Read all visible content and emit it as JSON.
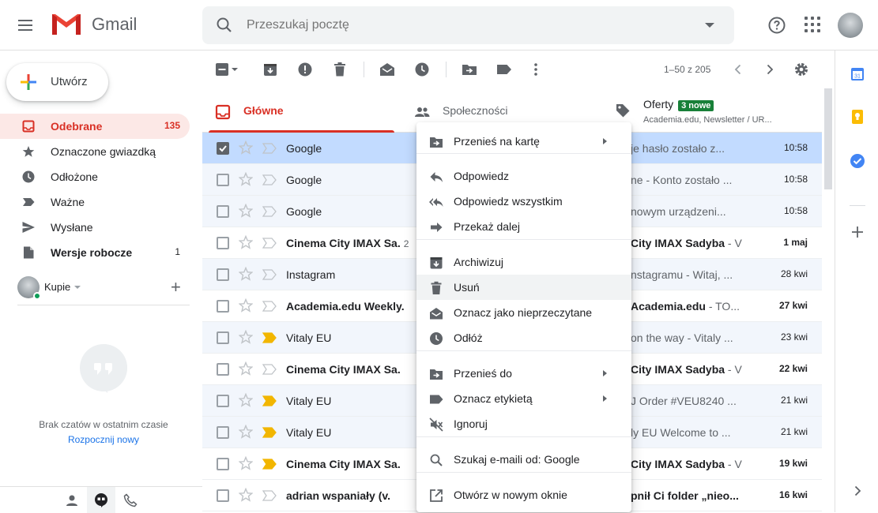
{
  "app": {
    "name": "Gmail"
  },
  "search": {
    "placeholder": "Przeszukaj pocztę"
  },
  "compose": {
    "label": "Utwórz"
  },
  "nav": [
    {
      "label": "Odebrane",
      "count": "135",
      "icon": "inbox-icon",
      "active": true
    },
    {
      "label": "Oznaczone gwiazdką",
      "count": "",
      "icon": "star-icon"
    },
    {
      "label": "Odłożone",
      "count": "",
      "icon": "clock-icon"
    },
    {
      "label": "Ważne",
      "count": "",
      "icon": "important-icon"
    },
    {
      "label": "Wysłane",
      "count": "",
      "icon": "send-icon"
    },
    {
      "label": "Wersje robocze",
      "count": "1",
      "icon": "draft-icon",
      "bold": true
    }
  ],
  "hangouts": {
    "user": "Kupie",
    "no_chats": "Brak czatów w ostatnim czasie",
    "start_new": "Rozpocznij nowy"
  },
  "toolbar": {
    "pagination": "1–50 z 205"
  },
  "tabs": [
    {
      "label": "Główne",
      "icon": "inbox-tab-icon",
      "active": true
    },
    {
      "label": "Społeczności",
      "icon": "people-icon"
    },
    {
      "label": "Oferty",
      "icon": "tag-icon",
      "badge": "3 nowe",
      "sub": "Academia.edu, Newsletter / UR..."
    }
  ],
  "emails": [
    {
      "sender": "Google",
      "count": "",
      "subject_bold": "",
      "subject_rest": "je hasło zostało z...",
      "date": "10:58",
      "unread": false,
      "selected": true,
      "important": false
    },
    {
      "sender": "Google",
      "count": "",
      "subject_bold": "",
      "subject_rest": "ne - Konto zostało ...",
      "date": "10:58",
      "unread": false,
      "selected": false,
      "important": false
    },
    {
      "sender": "Google",
      "count": "",
      "subject_bold": "",
      "subject_rest": " nowym urządzeni...",
      "date": "10:58",
      "unread": false,
      "selected": false,
      "important": false
    },
    {
      "sender": "Cinema City IMAX Sa.",
      "count": "2",
      "subject_bold": "City IMAX Sadyba",
      "subject_rest": " - V",
      "date": "1 maj",
      "unread": true,
      "selected": false,
      "important": false
    },
    {
      "sender": "Instagram",
      "count": "",
      "subject_bold": "",
      "subject_rest": "nstagramu - Witaj, ...",
      "date": "28 kwi",
      "unread": false,
      "selected": false,
      "important": false
    },
    {
      "sender": "Academia.edu Weekly.",
      "count": "",
      "subject_bold": "Academia.edu",
      "subject_rest": " - TO...",
      "date": "27 kwi",
      "unread": true,
      "selected": false,
      "important": false
    },
    {
      "sender": "Vitaly EU",
      "count": "",
      "subject_bold": "",
      "subject_rest": "on the way - Vitaly ...",
      "date": "23 kwi",
      "unread": false,
      "selected": false,
      "important": true
    },
    {
      "sender": "Cinema City IMAX Sa.",
      "count": "",
      "subject_bold": "City IMAX Sadyba",
      "subject_rest": " - V",
      "date": "22 kwi",
      "unread": true,
      "selected": false,
      "important": false
    },
    {
      "sender": "Vitaly EU",
      "count": "",
      "subject_bold": "",
      "subject_rest": "J Order #VEU8240 ...",
      "date": "21 kwi",
      "unread": false,
      "selected": false,
      "important": true
    },
    {
      "sender": "Vitaly EU",
      "count": "",
      "subject_bold": "",
      "subject_rest": "ly EU Welcome to ...",
      "date": "21 kwi",
      "unread": false,
      "selected": false,
      "important": true
    },
    {
      "sender": "Cinema City IMAX Sa.",
      "count": "",
      "subject_bold": "City IMAX Sadyba",
      "subject_rest": " - V",
      "date": "19 kwi",
      "unread": true,
      "selected": false,
      "important": true
    },
    {
      "sender": "adrian wspaniały (v.",
      "count": "",
      "subject_bold": "pnił Ci folder „nieo...",
      "subject_rest": "",
      "date": "16 kwi",
      "unread": true,
      "selected": false,
      "important": false
    }
  ],
  "context_menu": [
    {
      "label": "Przenieś na kartę",
      "icon": "move-to-tab-icon",
      "submenu": true
    },
    {
      "label": "Odpowiedz",
      "icon": "reply-icon"
    },
    {
      "label": "Odpowiedz wszystkim",
      "icon": "reply-all-icon"
    },
    {
      "label": "Przekaż dalej",
      "icon": "forward-icon"
    },
    {
      "label": "Archiwizuj",
      "icon": "archive-icon"
    },
    {
      "label": "Usuń",
      "icon": "trash-icon",
      "hover": true
    },
    {
      "label": "Oznacz jako nieprzeczytane",
      "icon": "mark-unread-icon"
    },
    {
      "label": "Odłóż",
      "icon": "snooze-icon"
    },
    {
      "label": "Przenieś do",
      "icon": "move-to-icon",
      "submenu": true
    },
    {
      "label": "Oznacz etykietą",
      "icon": "label-icon",
      "submenu": true
    },
    {
      "label": "Ignoruj",
      "icon": "mute-icon"
    },
    {
      "label": "Szukaj e-maili od: Google",
      "icon": "search-icon"
    },
    {
      "label": "Otwórz w nowym oknie",
      "icon": "open-new-window-icon"
    }
  ],
  "colors": {
    "accent": "#d93025",
    "selected_row": "#c2dbff",
    "read_row": "#f2f6fc",
    "badge": "#188038",
    "link": "#1a73e8"
  }
}
